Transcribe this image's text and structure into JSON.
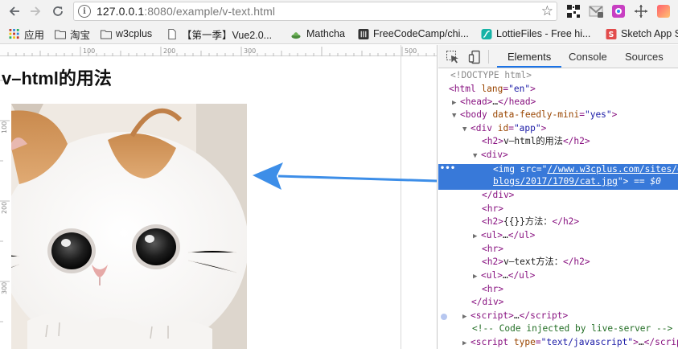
{
  "browser": {
    "url_host": "127.0.0.1",
    "url_rest": ":8080/example/v-text.html"
  },
  "bookmarks": [
    {
      "label": "应用",
      "icon": "apps-grid-icon"
    },
    {
      "label": "淘宝",
      "icon": "folder-icon"
    },
    {
      "label": "w3cplus",
      "icon": "folder-icon"
    },
    {
      "label": "【第一季】Vue2.0...",
      "icon": "page-icon"
    },
    {
      "label": "Mathcha",
      "icon": "mathcha-icon"
    },
    {
      "label": "FreeCodeCamp/chi...",
      "icon": "github-icon"
    },
    {
      "label": "LottieFiles - Free hi...",
      "icon": "lottie-icon"
    },
    {
      "label": "Sketch App S",
      "icon": "sketch-icon"
    }
  ],
  "page": {
    "heading": "v–html的用法",
    "ruler_top": [
      "100",
      "200",
      "300",
      "500"
    ],
    "ruler_left": [
      "100",
      "200",
      "300"
    ]
  },
  "devtools": {
    "tabs": [
      "Elements",
      "Console",
      "Sources"
    ],
    "active_tab": "Elements",
    "selected_marker": "== $0"
  },
  "colors": {
    "selection": "#3879d9",
    "arrow": "#3d8ee8",
    "tab_underline": "#1a73e8"
  }
}
